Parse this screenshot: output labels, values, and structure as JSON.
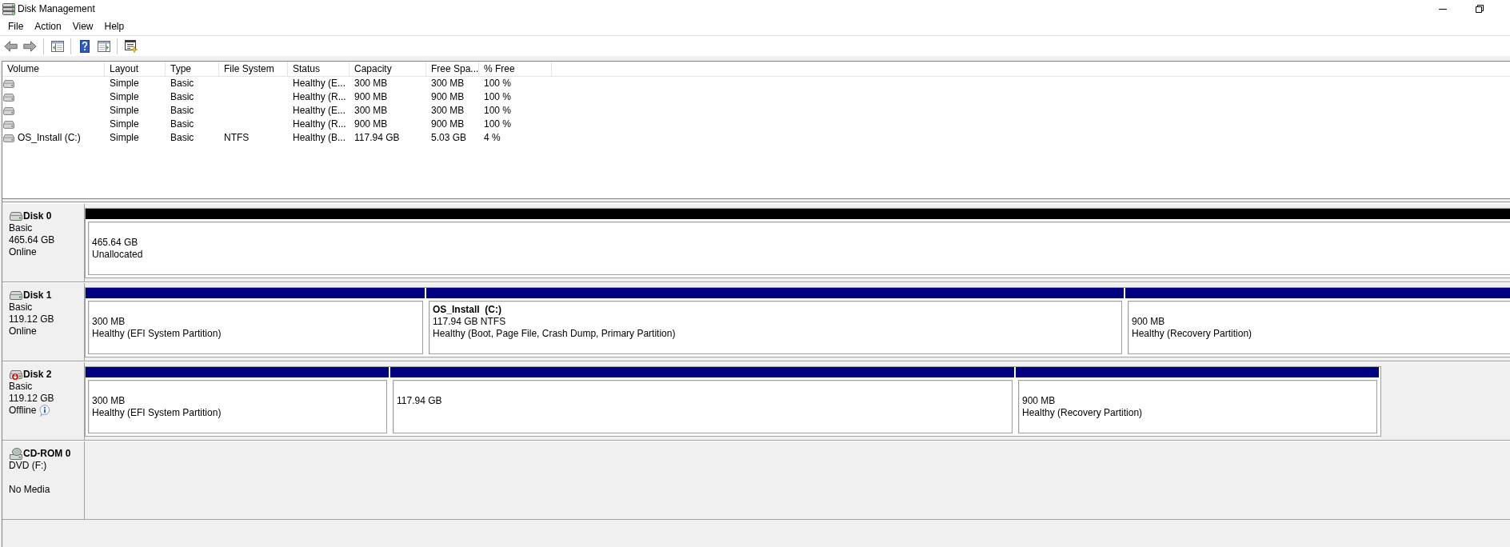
{
  "window": {
    "title": "Disk Management",
    "controls": [
      {
        "kind": "minimize"
      },
      {
        "kind": "restore"
      }
    ]
  },
  "menu": [
    "File",
    "Action",
    "View",
    "Help"
  ],
  "toolbar": [
    {
      "kind": "back"
    },
    {
      "kind": "forward"
    },
    {
      "kind": "separator"
    },
    {
      "kind": "console_tree"
    },
    {
      "kind": "separator"
    },
    {
      "kind": "help"
    },
    {
      "kind": "action_pane"
    },
    {
      "kind": "separator"
    },
    {
      "kind": "properties"
    }
  ],
  "volume_list": {
    "columns": [
      "Volume",
      "Layout",
      "Type",
      "File System",
      "Status",
      "Capacity",
      "Free Spa...",
      "% Free"
    ],
    "rows": [
      {
        "layout": "Simple",
        "type": "Basic",
        "status": "Healthy (E...",
        "capacity": "300 MB",
        "free_space": "300 MB",
        "percent_free": "100 %"
      },
      {
        "layout": "Simple",
        "type": "Basic",
        "status": "Healthy (R...",
        "capacity": "900 MB",
        "free_space": "900 MB",
        "percent_free": "100 %"
      },
      {
        "layout": "Simple",
        "type": "Basic",
        "status": "Healthy (E...",
        "capacity": "300 MB",
        "free_space": "300 MB",
        "percent_free": "100 %"
      },
      {
        "layout": "Simple",
        "type": "Basic",
        "status": "Healthy (R...",
        "capacity": "900 MB",
        "free_space": "900 MB",
        "percent_free": "100 %"
      },
      {
        "volume": "OS_Install (C:)",
        "layout": "Simple",
        "type": "Basic",
        "file_system": "NTFS",
        "status": "Healthy (B...",
        "capacity": "117.94 GB",
        "free_space": "5.03 GB",
        "percent_free": "4 %"
      }
    ]
  },
  "disks": [
    {
      "kind": "hdd",
      "name": "Disk 0",
      "type": "Basic",
      "size": "465.64 GB",
      "status": "Online",
      "info_icon": false,
      "partitions": [
        {
          "color": "#000000",
          "size": "465.64 GB",
          "status": "Unallocated"
        }
      ]
    },
    {
      "kind": "hdd",
      "name": "Disk 1",
      "type": "Basic",
      "size": "119.12 GB",
      "status": "Online",
      "info_icon": false,
      "partitions": [
        {
          "color": "#000080",
          "size": "300 MB",
          "status": "Healthy (EFI System Partition)"
        },
        {
          "color": "#000080",
          "name": "OS_Install  (C:)",
          "size": "117.94 GB NTFS",
          "status": "Healthy (Boot, Page File, Crash Dump, Primary Partition)"
        },
        {
          "color": "#000080",
          "size": "900 MB",
          "status": "Healthy (Recovery Partition)"
        }
      ]
    },
    {
      "kind": "hdd_offline",
      "name": "Disk 2",
      "type": "Basic",
      "size": "119.12 GB",
      "status": "Offline",
      "info_icon": true,
      "partitions": [
        {
          "color": "#000080",
          "size": "300 MB",
          "status": "Healthy (EFI System Partition)"
        },
        {
          "color": "#000080",
          "size": "117.94 GB"
        },
        {
          "color": "#000080",
          "size": "900 MB",
          "status": "Healthy (Recovery Partition)"
        }
      ]
    },
    {
      "kind": "optical",
      "name": "CD-ROM 0",
      "type": "DVD (F:)",
      "status": "No Media",
      "info_icon": false
    }
  ]
}
